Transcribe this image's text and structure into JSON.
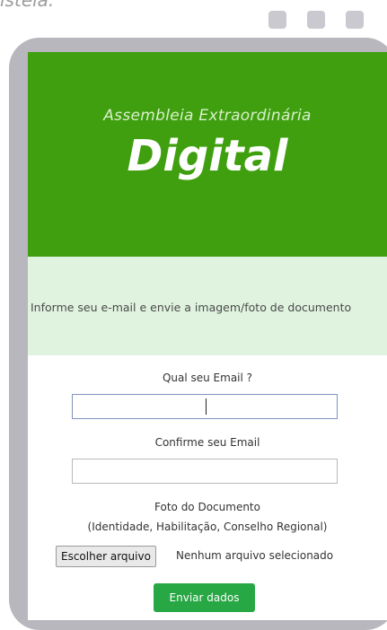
{
  "header_fragment": "isteia.",
  "hero": {
    "subtitle": "Assembleia Extraordinária",
    "title": "Digital"
  },
  "info": {
    "text": "Informe seu e-mail e envie a imagem/foto de documento"
  },
  "form": {
    "email_label": "Qual seu Email ?",
    "email_value": "",
    "confirm_label": "Confirme seu Email",
    "confirm_value": "",
    "document_label": "Foto do Documento",
    "document_hint": "(Identidade, Habilitação, Conselho Regional)",
    "file_button_label": "Escolher arquivo",
    "file_status": "Nenhum arquivo selecionado",
    "submit_label": "Enviar dados"
  },
  "colors": {
    "hero_green": "#3f9f0f",
    "info_band": "#dff3df",
    "submit_green": "#28a745",
    "frame_gray": "#b7b7bd"
  }
}
